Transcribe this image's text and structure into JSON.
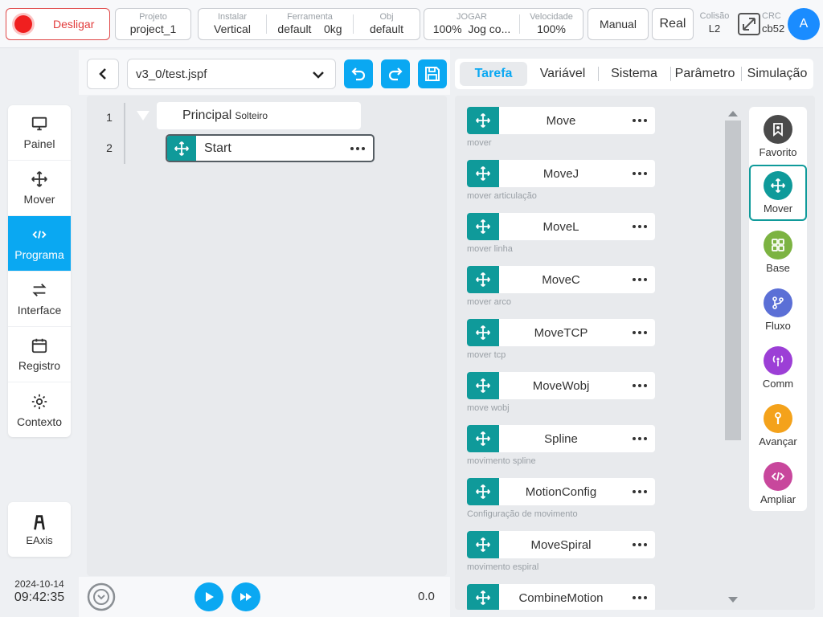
{
  "topbar": {
    "power_label": "Desligar",
    "projeto": {
      "label": "Projeto",
      "value": "project_1"
    },
    "instalar": {
      "label": "Instalar",
      "value": "Vertical"
    },
    "ferramenta": {
      "label": "Ferramenta",
      "value1": "default",
      "value2": "0kg"
    },
    "obj": {
      "label": "Obj",
      "value": "default"
    },
    "jogar": {
      "label": "JOGAR",
      "value1": "100%",
      "value2": "Jog co..."
    },
    "velocidade": {
      "label": "Velocidade",
      "value": "100%"
    },
    "mode_button": "Manual",
    "real_button": "Real",
    "colisao": {
      "label": "Colisão",
      "value": "L2"
    },
    "crc": {
      "label": "CRC",
      "value": "cb52"
    },
    "avatar_letter": "A"
  },
  "leftnav": {
    "items": [
      {
        "label": "Painel",
        "icon": "monitor-icon"
      },
      {
        "label": "Mover",
        "icon": "move-icon"
      },
      {
        "label": "Programa",
        "icon": "code-icon"
      },
      {
        "label": "Interface",
        "icon": "swap-icon"
      },
      {
        "label": "Registro",
        "icon": "calendar-icon"
      },
      {
        "label": "Contexto",
        "icon": "gear-icon"
      }
    ],
    "eaxis_label": "EAxis",
    "date": "2024-10-14",
    "time": "09:42:35"
  },
  "editor": {
    "file": "v3_0/test.jspf",
    "lines": [
      "1",
      "2"
    ],
    "main_label": "Principal",
    "main_sub": "Solteiro",
    "start_label": "Start",
    "speed_readout": "0.0"
  },
  "tabs": [
    "Tarefa",
    "Variável",
    "Sistema",
    "Parâmetro",
    "Simulação"
  ],
  "commands": [
    {
      "name": "Move",
      "desc": "mover"
    },
    {
      "name": "MoveJ",
      "desc": "mover articulação"
    },
    {
      "name": "MoveL",
      "desc": "mover linha"
    },
    {
      "name": "MoveC",
      "desc": "mover arco"
    },
    {
      "name": "MoveTCP",
      "desc": "mover tcp"
    },
    {
      "name": "MoveWobj",
      "desc": "move wobj"
    },
    {
      "name": "Spline",
      "desc": "movimento spline"
    },
    {
      "name": "MotionConfig",
      "desc": "Configuração de movimento"
    },
    {
      "name": "MoveSpiral",
      "desc": "movimento espiral"
    },
    {
      "name": "CombineMotion",
      "desc": ""
    }
  ],
  "categories": [
    {
      "label": "Favorito",
      "color": "#4a4a4a"
    },
    {
      "label": "Mover",
      "color": "#0f9a9a"
    },
    {
      "label": "Base",
      "color": "#7cb342"
    },
    {
      "label": "Fluxo",
      "color": "#5b6fd6"
    },
    {
      "label": "Comm",
      "color": "#9c3fd6"
    },
    {
      "label": "Avançar",
      "color": "#f4a21b"
    },
    {
      "label": "Ampliar",
      "color": "#c8479c"
    }
  ],
  "colors": {
    "accent": "#0aa8f2",
    "teal": "#0f9a9a",
    "danger": "#e23b3b"
  }
}
